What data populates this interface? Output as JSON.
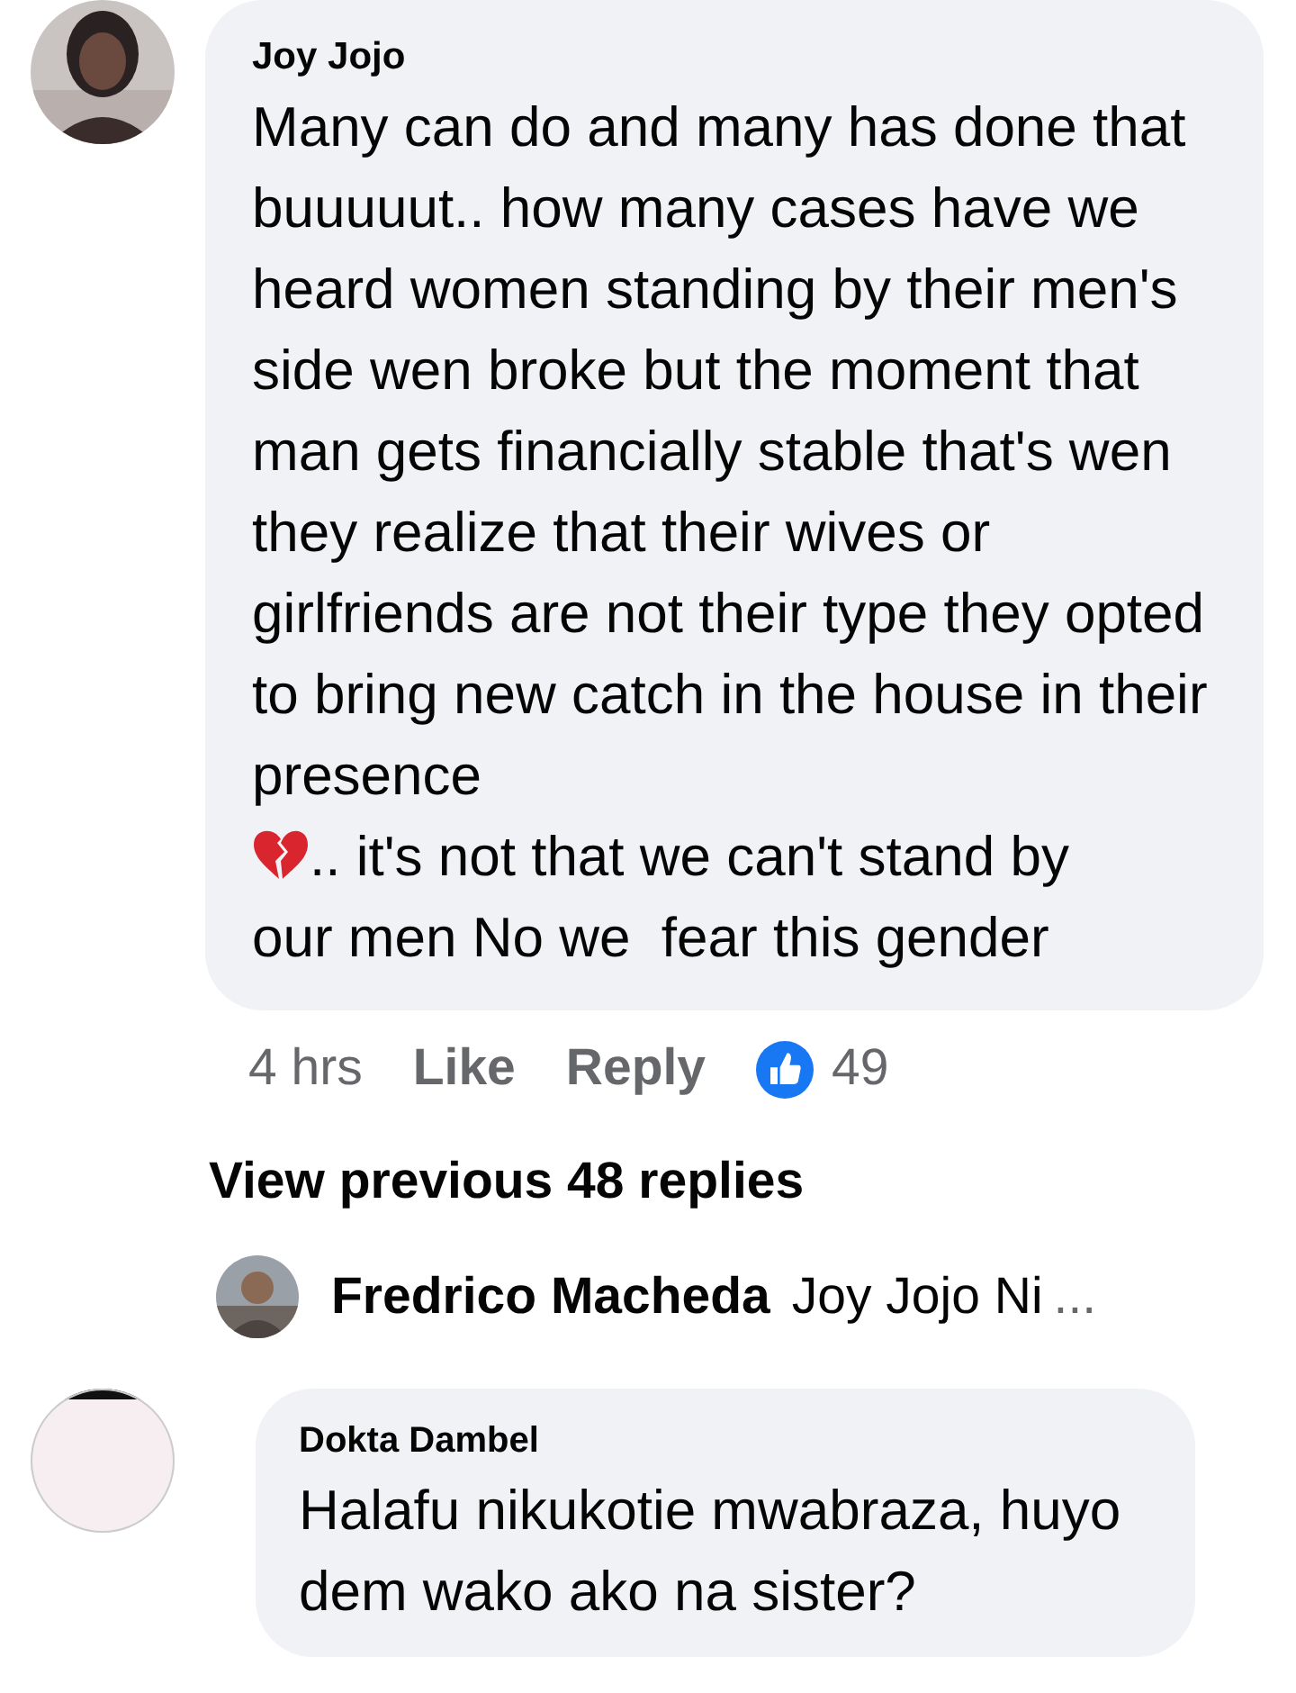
{
  "comment": {
    "author": "Joy Jojo",
    "text": "Many can do and many has done that buuuuut.. how many cases have we heard women standing by their men's side wen broke but the moment that man gets financially stable that's wen they realize that their wives or girlfriends are not their type they opted to bring new catch in the house in their presence",
    "text_after_emoji": [
      ".. it's not that we can't stand by",
      "our men No we  fear this gender"
    ],
    "time": "4 hrs",
    "actions": [
      "Like",
      "Reply"
    ],
    "reaction_count": "49"
  },
  "view_previous": "View previous 48 replies",
  "reply_preview": {
    "author": "Fredrico Macheda",
    "text": "Joy Jojo Ni",
    "more": "..."
  },
  "next_comment": {
    "author": "Dokta Dambel",
    "text": "Halafu nikukotie mwabraza, huyo dem wako ako na sister?"
  }
}
